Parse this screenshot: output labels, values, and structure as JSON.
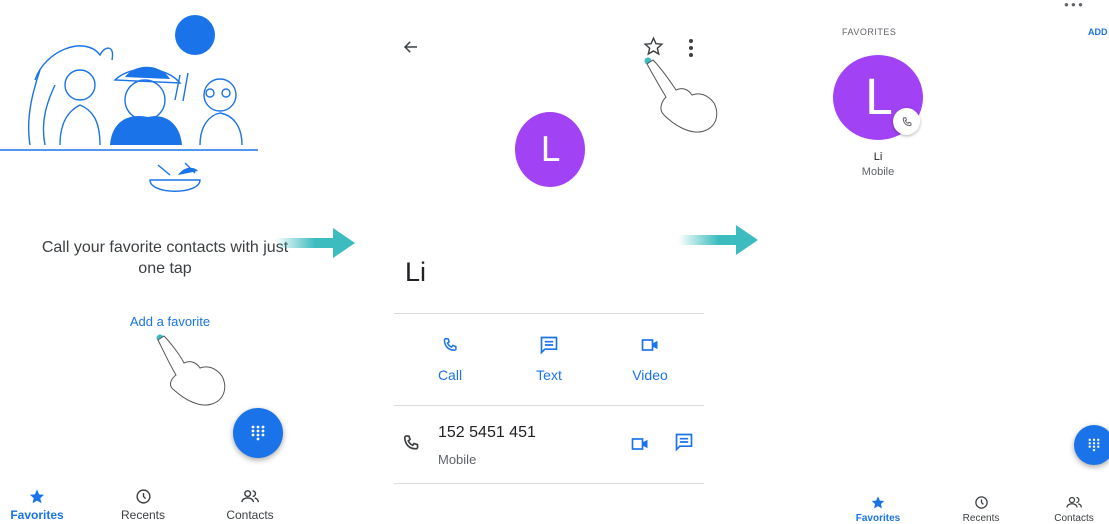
{
  "panel1": {
    "empty_state_text": "Call your favorite contacts with just one tap",
    "add_favorite_link": "Add a favorite",
    "bottom_nav": [
      {
        "label": "Favorites",
        "icon": "star-icon",
        "active": true
      },
      {
        "label": "Recents",
        "icon": "clock-icon",
        "active": false
      },
      {
        "label": "Contacts",
        "icon": "people-icon",
        "active": false
      }
    ]
  },
  "panel2": {
    "avatar_letter": "L",
    "contact_name": "Li",
    "actions": {
      "call": "Call",
      "text": "Text",
      "video": "Video"
    },
    "phone": {
      "number": "152 5451 451",
      "type": "Mobile"
    }
  },
  "panel3": {
    "section_label": "FAVORITES",
    "add_label": "ADD",
    "favorite": {
      "letter": "L",
      "name": "Li",
      "type": "Mobile"
    },
    "bottom_nav": [
      {
        "label": "Favorites",
        "icon": "star-icon",
        "active": true
      },
      {
        "label": "Recents",
        "icon": "clock-icon",
        "active": false
      },
      {
        "label": "Contacts",
        "icon": "people-icon",
        "active": false
      }
    ]
  },
  "colors": {
    "accent": "#1a73e8",
    "avatar": "#a142f4",
    "arrow": "#3dbcc0"
  }
}
